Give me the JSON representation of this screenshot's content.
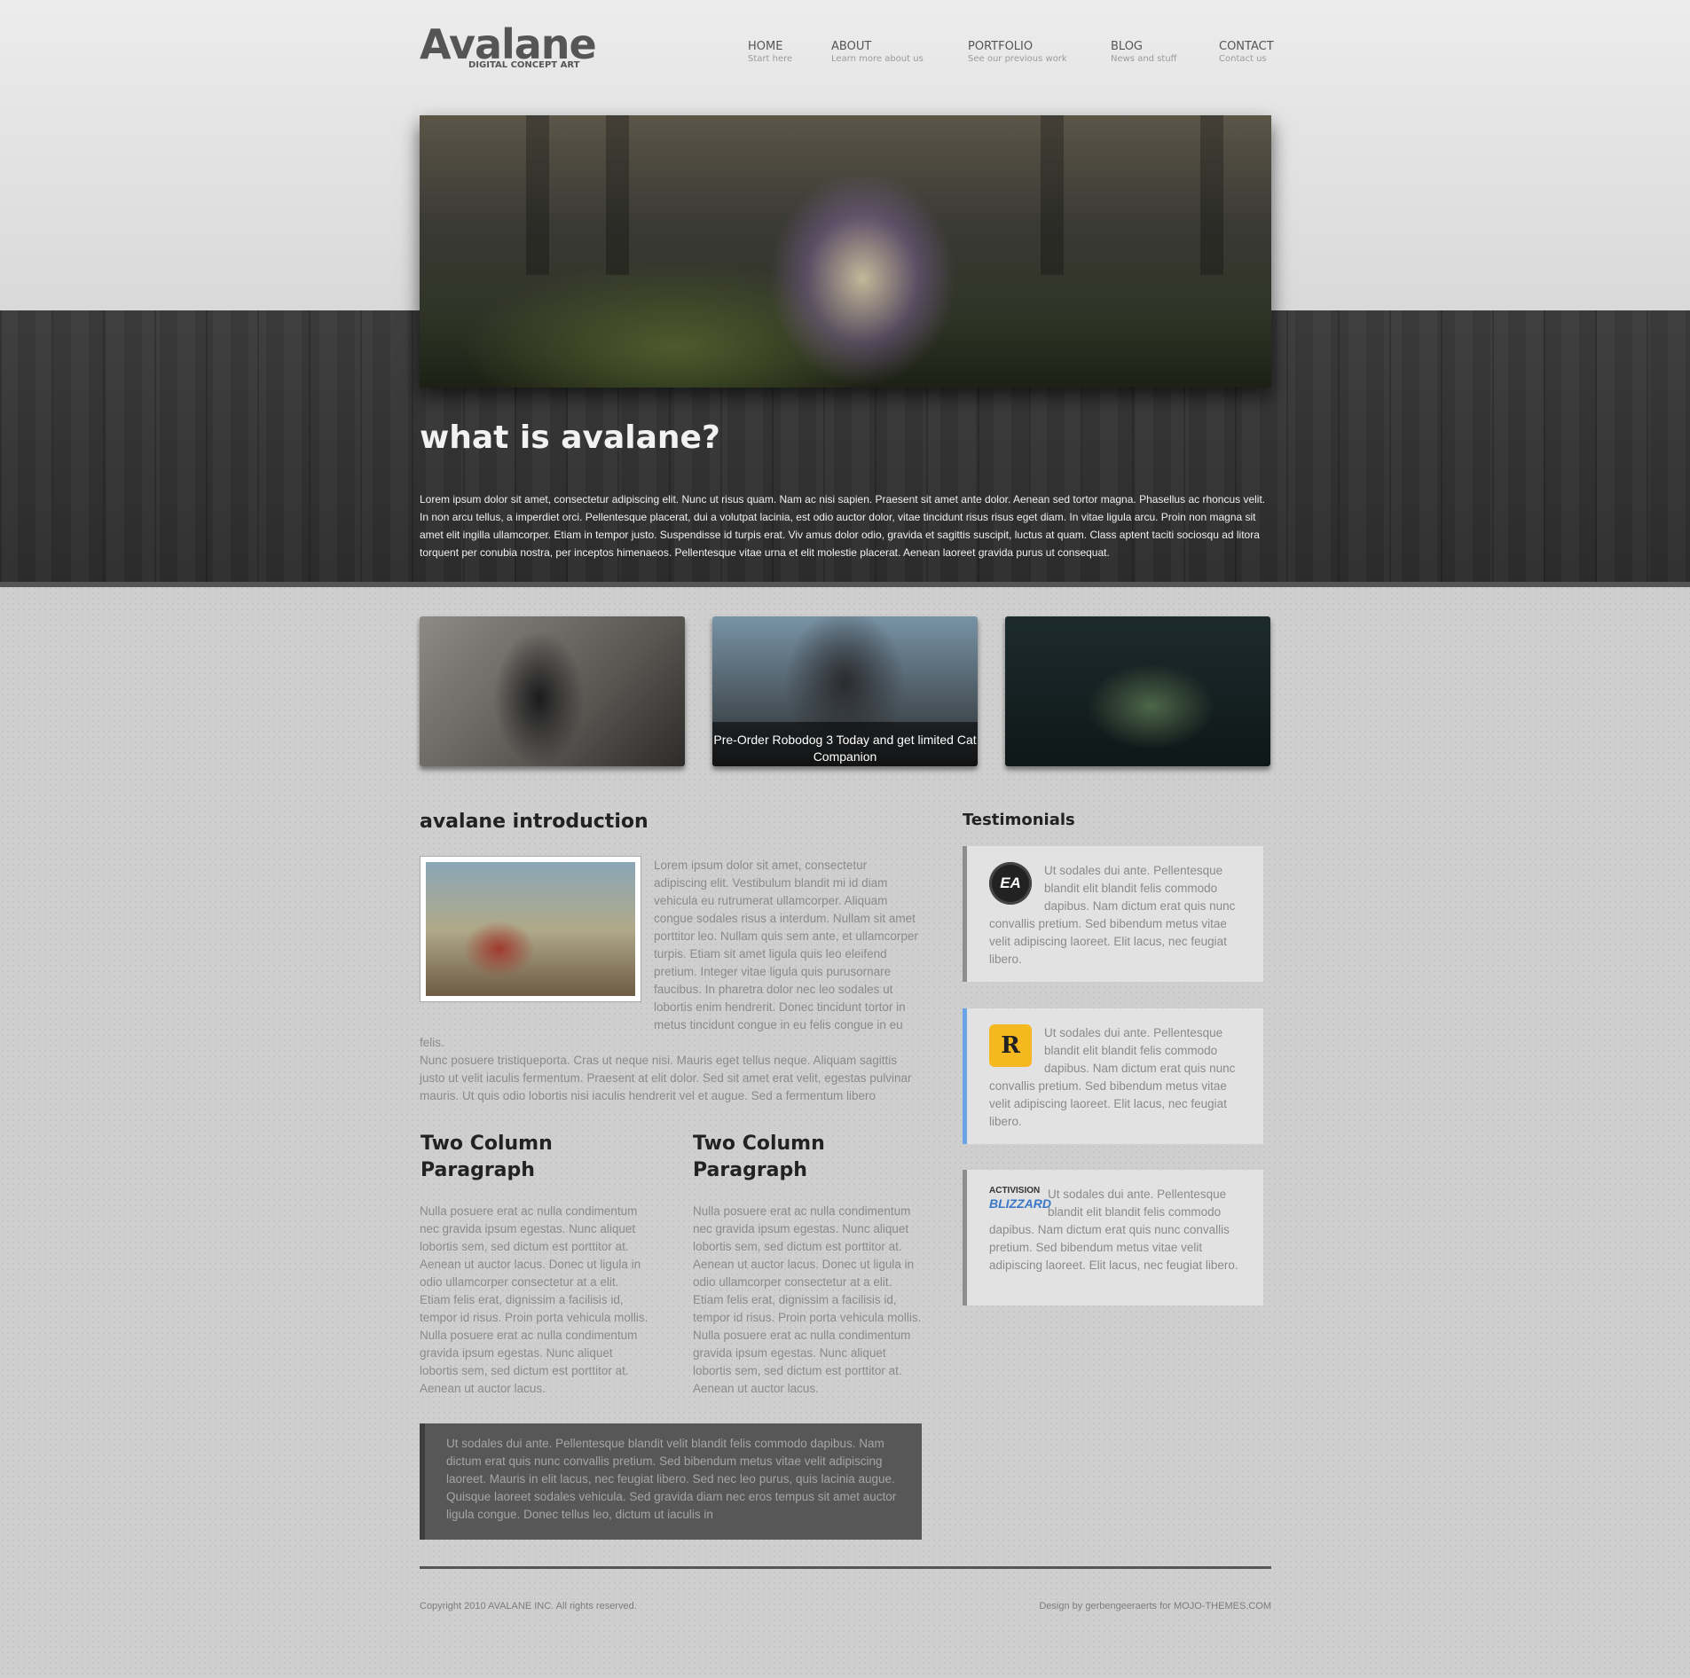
{
  "header": {
    "logo_name": "Avalane",
    "logo_tagline": "DIGITAL CONCEPT ART",
    "nav": [
      {
        "label": "HOME",
        "sub": "Start here"
      },
      {
        "label": "ABOUT",
        "sub": "Learn more about us"
      },
      {
        "label": "PORTFOLIO",
        "sub": "See our previous work"
      },
      {
        "label": "BLOG",
        "sub": "News and stuff"
      },
      {
        "label": "CONTACT",
        "sub": "Contact us"
      }
    ]
  },
  "about": {
    "heading": "what is avalane?",
    "text": "Lorem ipsum dolor sit amet, consectetur adipiscing elit. Nunc ut risus quam. Nam ac nisi sapien. Praesent sit amet ante dolor. Aenean sed tortor magna. Phasellus ac rhoncus velit. In non arcu tellus, a imperdiet orci. Pellentesque placerat, dui a volutpat lacinia, est odio auctor dolor, vitae tincidunt risus risus eget diam. In vitae ligula arcu. Proin non magna sit amet elit ingilla ullamcorper. Etiam in tempor justo. Suspendisse id turpis erat. Viv amus dolor odio, gravida et sagittis suscipit, luctus at quam. Class aptent taciti sociosqu ad litora torquent per conubia nostra, per inceptos himenaeos. Pellentesque vitae urna et elit molestie placerat. Aenean laoreet gravida purus ut consequat."
  },
  "thumbs": {
    "caption": "Pre-Order Robodog 3 Today and get limited Cat Companion"
  },
  "intro": {
    "heading": "avalane introduction",
    "text1": "Lorem ipsum dolor sit amet, consectetur adipiscing elit. Vestibulum blandit mi id diam vehicula eu rutrumerat ullamcorper. Aliquam congue sodales risus a interdum. Nullam sit amet porttitor leo. Nullam quis sem ante, et ullamcorper turpis. Etiam sit amet ligula quis leo eleifend pretium. Integer vitae ligula quis purusornare faucibus. In pharetra dolor nec leo sodales ut lobortis enim hendrerit. Donec tincidunt tortor in metus tincidunt congue in eu felis congue in eu felis.",
    "text2": "Nunc posuere tristiqueporta. Cras ut neque nisi. Mauris eget tellus neque. Aliquam sagittis justo ut velit iaculis fermentum. Praesent at elit dolor. Sed sit amet erat velit, egestas pulvinar mauris. Ut quis odio lobortis nisi iaculis hendrerit vel et augue. Sed a fermentum libero"
  },
  "columns": [
    {
      "heading": "Two Column Paragraph",
      "text": "Nulla posuere erat ac nulla condimentum nec gravida ipsum egestas. Nunc aliquet lobortis sem, sed dictum est porttitor at. Aenean ut auctor lacus. Donec ut ligula in odio ullamcorper consectetur at a elit. Etiam felis erat, dignissim a facilisis id, tempor id risus. Proin porta vehicula mollis. Nulla posuere erat ac nulla condimentum gravida ipsum egestas. Nunc aliquet lobortis sem, sed dictum est porttitor at. Aenean ut auctor lacus."
    },
    {
      "heading": "Two Column Paragraph",
      "text": "Nulla posuere erat ac nulla condimentum nec gravida ipsum egestas. Nunc aliquet lobortis sem, sed dictum est porttitor at. Aenean ut auctor lacus. Donec ut ligula in odio ullamcorper consectetur at a elit. Etiam felis erat, dignissim a facilisis id, tempor id risus. Proin porta vehicula mollis. Nulla posuere erat ac nulla condimentum gravida ipsum egestas. Nunc aliquet lobortis sem, sed dictum est porttitor at. Aenean ut auctor lacus."
    }
  ],
  "quote": "Ut sodales dui ante. Pellentesque blandit velit blandit felis commodo dapibus. Nam dictum erat quis nunc convallis pretium. Sed bibendum metus vitae velit adipiscing laoreet. Mauris in elit lacus, nec feugiat libero. Sed nec leo purus, quis lacinia augue. Quisque laoreet sodales vehicula. Sed gravida diam nec eros tempus sit amet auctor ligula congue. Donec tellus leo, dictum ut iaculis in",
  "testimonials": {
    "heading": "Testimonials",
    "items": [
      {
        "logo": "EA",
        "text": "Ut sodales dui ante. Pellentesque blandit elit blandit felis commodo dapibus. Nam dictum erat quis nunc convallis pretium. Sed bibendum metus vitae velit adipiscing laoreet. Elit lacus, nec feugiat libero."
      },
      {
        "logo": "R",
        "text": "Ut sodales dui ante. Pellentesque blandit elit blandit felis commodo dapibus. Nam dictum erat quis nunc convallis pretium. Sed bibendum metus vitae velit adipiscing laoreet. Elit lacus, nec feugiat libero."
      },
      {
        "logo_top": "ACTIVISION",
        "logo_bottom": "BLIZZARD",
        "text": "Ut sodales dui ante. Pellentesque blandit elit blandit felis commodo dapibus. Nam dictum erat quis nunc convallis pretium. Sed bibendum metus vitae velit adipiscing laoreet. Elit lacus, nec feugiat libero."
      }
    ]
  },
  "footer": {
    "copyright": "Copyright 2010 AVALANE INC. All rights reserved.",
    "credit": "Design by gerbengeeraerts for MOJO-THEMES.COM"
  },
  "colors": {
    "accent_blue": "#6aa3e6",
    "wood_dark": "#2f2f2f",
    "text_gray": "#8a8a8a"
  }
}
